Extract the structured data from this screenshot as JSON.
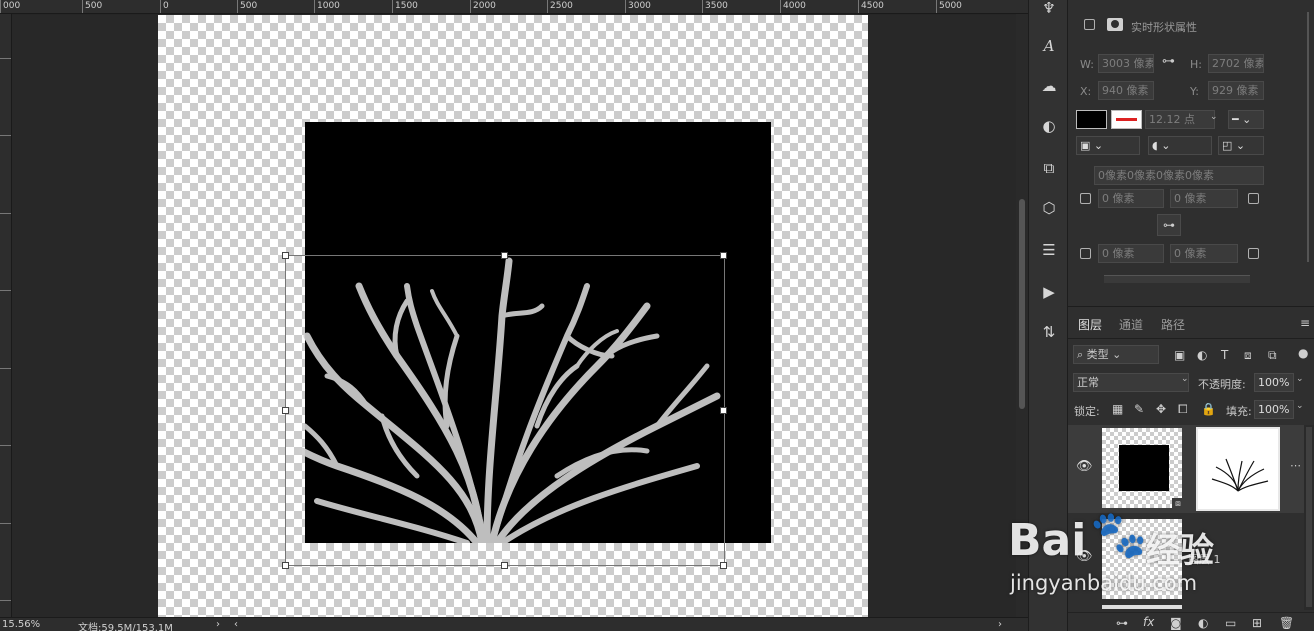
{
  "ruler": {
    "labels": [
      "000",
      "500",
      "0",
      "500",
      "1000",
      "1500",
      "2000",
      "2500",
      "3000",
      "3500",
      "4000",
      "4500",
      "5000"
    ]
  },
  "status": {
    "zoom": "15.56%",
    "doc": "文档:59.5M/153.1M"
  },
  "properties": {
    "title": "实时形状属性",
    "w_label": "W:",
    "w_value": "3003 像素",
    "h_label": "H:",
    "h_value": "2702 像素",
    "x_label": "X:",
    "x_value": "940 像素",
    "y_label": "Y:",
    "y_value": "929 像素",
    "stroke_size": "12.12 点",
    "corners_all": "0像素0像素0像素0像素",
    "corner_tl": "0 像素",
    "corner_tr": "0 像素",
    "corner_bl": "0 像素",
    "corner_br": "0 像素"
  },
  "layers": {
    "tabs": [
      "图层",
      "通道",
      "路径"
    ],
    "filter_kind": "类型",
    "blend_mode": "正常",
    "opacity_label": "不透明度:",
    "opacity_value": "100%",
    "lock_label": "锁定:",
    "fill_label": "填充:",
    "fill_value": "100%",
    "second_layer_name": "图层 1"
  },
  "watermark": {
    "brand": "Bai",
    "brand2": "经验",
    "site": "jingyanbaidu.com"
  }
}
